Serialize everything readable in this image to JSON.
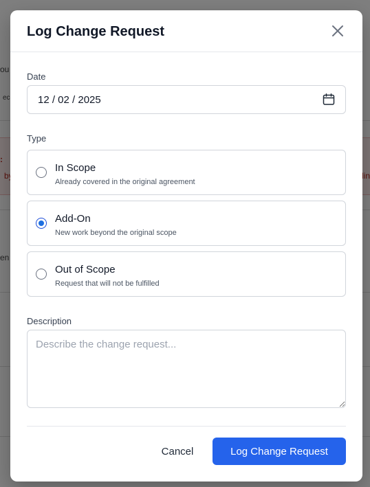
{
  "background": {
    "fragments": [
      "ou",
      "ec",
      ":",
      "by",
      "lin",
      "en"
    ]
  },
  "modal": {
    "title": "Log Change Request",
    "close_icon": "close-icon",
    "date": {
      "label": "Date",
      "value": "12 / 02 / 2025",
      "icon": "calendar-icon"
    },
    "type": {
      "label": "Type",
      "selected": "Add-On",
      "options": [
        {
          "title": "In Scope",
          "description": "Already covered in the original agreement",
          "checked": false
        },
        {
          "title": "Add-On",
          "description": "New work beyond the original scope",
          "checked": true
        },
        {
          "title": "Out of Scope",
          "description": "Request that will not be fulfilled",
          "checked": false
        }
      ]
    },
    "description": {
      "label": "Description",
      "value": "",
      "placeholder": "Describe the change request..."
    },
    "footer": {
      "cancel_label": "Cancel",
      "submit_label": "Log Change Request"
    }
  },
  "colors": {
    "accent": "#2563eb",
    "radio_checked": "#1d6fe0",
    "overlay": "rgba(0,0,0,0.5)",
    "alert_bg": "#fdecec",
    "alert_text": "#b42318"
  }
}
